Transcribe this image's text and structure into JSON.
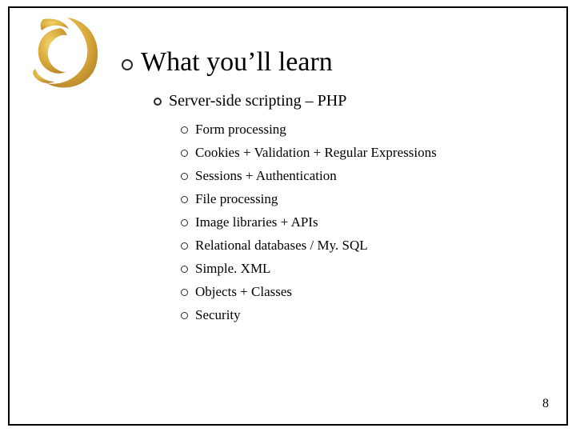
{
  "heading": "What you’ll learn",
  "sub1": "Server-side scripting – PHP",
  "items": [
    "Form processing",
    "Cookies + Validation + Regular Expressions",
    "Sessions + Authentication",
    "File processing",
    "Image libraries + APIs",
    "Relational databases / My. SQL",
    "Simple. XML",
    "Objects + Classes",
    "Security"
  ],
  "page_number": "8",
  "logo_color": "#d7a93a"
}
